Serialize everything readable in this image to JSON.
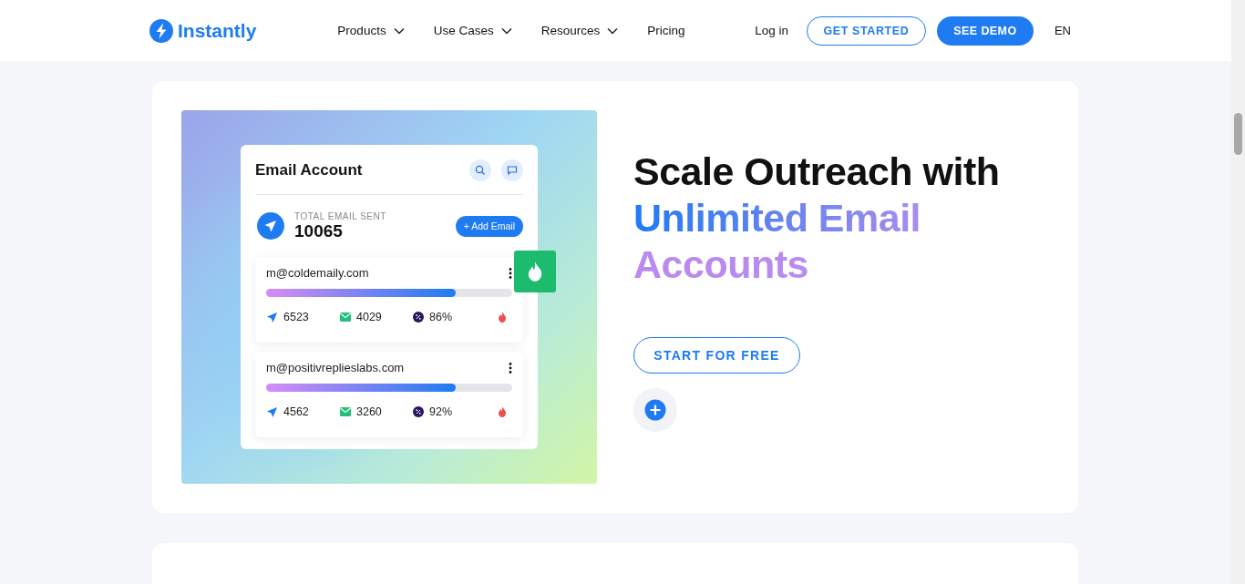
{
  "header": {
    "logo": "Instantly",
    "nav": [
      {
        "label": "Products",
        "dropdown": true
      },
      {
        "label": "Use Cases",
        "dropdown": true
      },
      {
        "label": "Resources",
        "dropdown": true
      },
      {
        "label": "Pricing",
        "dropdown": false
      }
    ],
    "login": "Log in",
    "get_started": "GET STARTED",
    "see_demo": "SEE DEMO",
    "language": "EN"
  },
  "hero": {
    "panel": {
      "title": "Email Account",
      "total_label": "TOTAL EMAIL SENT",
      "total": "10065",
      "add_button": "+ Add Email",
      "accounts": [
        {
          "email": "m@coldemaily.com",
          "level": 0.77,
          "sent": "6523",
          "replied": "4029",
          "rate": "86%"
        },
        {
          "email": "m@positivreplieslabs.com",
          "level": 0.77,
          "sent": "4562",
          "replied": "3260",
          "rate": "92%"
        }
      ]
    },
    "headline": [
      {
        "text": "Scale Outreach with",
        "kind": "plain"
      },
      {
        "text": "Unlimited Email",
        "kind": "gradient"
      },
      {
        "text": "Accounts",
        "kind": "accent"
      }
    ],
    "cta": "START FOR FREE"
  }
}
